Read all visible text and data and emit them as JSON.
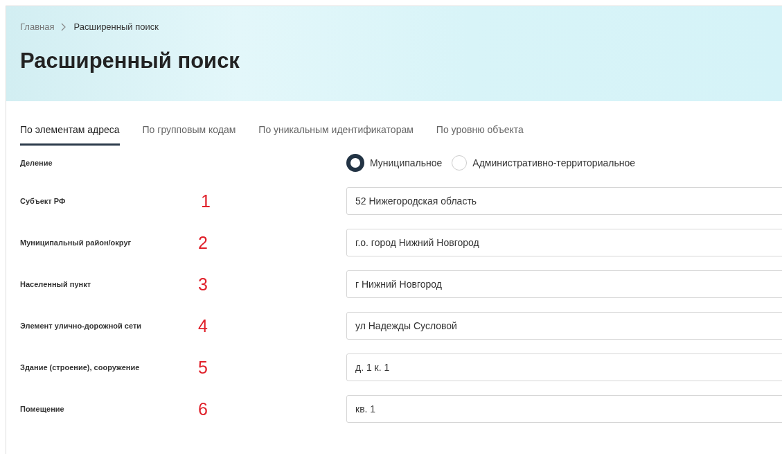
{
  "breadcrumbs": [
    {
      "label": "Главная",
      "current": false
    },
    {
      "label": "Расширенный поиск",
      "current": true
    }
  ],
  "title": "Расширенный поиск",
  "tabs": [
    {
      "label": "По элементам адреса",
      "selected": true
    },
    {
      "label": "По групповым кодам",
      "selected": false
    },
    {
      "label": "По уникальным идентификаторам",
      "selected": false
    },
    {
      "label": "По уровню объекта",
      "selected": false
    }
  ],
  "division": {
    "label": "Деление",
    "options": [
      {
        "label": "Муниципальное",
        "selected": true
      },
      {
        "label": "Административно-территориальное",
        "selected": false
      }
    ]
  },
  "fields": [
    {
      "label": "Субъект РФ",
      "marker": "1",
      "value": "52 Нижегородская область"
    },
    {
      "label": "Муниципальный район/округ",
      "marker": "2",
      "value": "г.о. город Нижний Новгород"
    },
    {
      "label": "Населенный пункт",
      "marker": "3",
      "value": "г Нижний Новгород"
    },
    {
      "label": "Элемент улично-дорожной сети",
      "marker": "4",
      "value": "ул Надежды Сусловой"
    },
    {
      "label": "Здание (строение), сооружение",
      "marker": "5",
      "value": "д. 1 к. 1"
    },
    {
      "label": "Помещение",
      "marker": "6",
      "value": "кв. 1"
    }
  ]
}
